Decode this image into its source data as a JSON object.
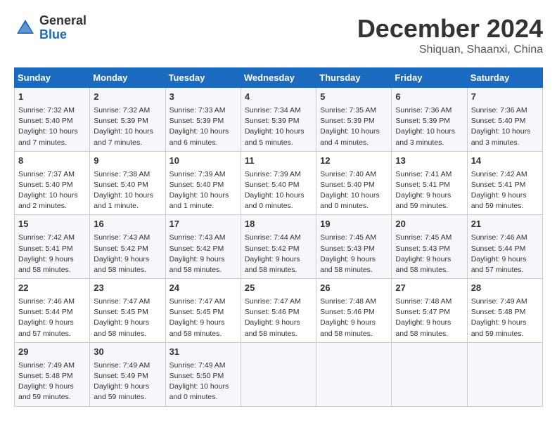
{
  "header": {
    "logo_general": "General",
    "logo_blue": "Blue",
    "month_year": "December 2024",
    "location": "Shiquan, Shaanxi, China"
  },
  "days_of_week": [
    "Sunday",
    "Monday",
    "Tuesday",
    "Wednesday",
    "Thursday",
    "Friday",
    "Saturday"
  ],
  "weeks": [
    [
      {
        "day": "1",
        "info": "Sunrise: 7:32 AM\nSunset: 5:40 PM\nDaylight: 10 hours and 7 minutes."
      },
      {
        "day": "2",
        "info": "Sunrise: 7:32 AM\nSunset: 5:39 PM\nDaylight: 10 hours and 7 minutes."
      },
      {
        "day": "3",
        "info": "Sunrise: 7:33 AM\nSunset: 5:39 PM\nDaylight: 10 hours and 6 minutes."
      },
      {
        "day": "4",
        "info": "Sunrise: 7:34 AM\nSunset: 5:39 PM\nDaylight: 10 hours and 5 minutes."
      },
      {
        "day": "5",
        "info": "Sunrise: 7:35 AM\nSunset: 5:39 PM\nDaylight: 10 hours and 4 minutes."
      },
      {
        "day": "6",
        "info": "Sunrise: 7:36 AM\nSunset: 5:39 PM\nDaylight: 10 hours and 3 minutes."
      },
      {
        "day": "7",
        "info": "Sunrise: 7:36 AM\nSunset: 5:40 PM\nDaylight: 10 hours and 3 minutes."
      }
    ],
    [
      {
        "day": "8",
        "info": "Sunrise: 7:37 AM\nSunset: 5:40 PM\nDaylight: 10 hours and 2 minutes."
      },
      {
        "day": "9",
        "info": "Sunrise: 7:38 AM\nSunset: 5:40 PM\nDaylight: 10 hours and 1 minute."
      },
      {
        "day": "10",
        "info": "Sunrise: 7:39 AM\nSunset: 5:40 PM\nDaylight: 10 hours and 1 minute."
      },
      {
        "day": "11",
        "info": "Sunrise: 7:39 AM\nSunset: 5:40 PM\nDaylight: 10 hours and 0 minutes."
      },
      {
        "day": "12",
        "info": "Sunrise: 7:40 AM\nSunset: 5:40 PM\nDaylight: 10 hours and 0 minutes."
      },
      {
        "day": "13",
        "info": "Sunrise: 7:41 AM\nSunset: 5:41 PM\nDaylight: 9 hours and 59 minutes."
      },
      {
        "day": "14",
        "info": "Sunrise: 7:42 AM\nSunset: 5:41 PM\nDaylight: 9 hours and 59 minutes."
      }
    ],
    [
      {
        "day": "15",
        "info": "Sunrise: 7:42 AM\nSunset: 5:41 PM\nDaylight: 9 hours and 58 minutes."
      },
      {
        "day": "16",
        "info": "Sunrise: 7:43 AM\nSunset: 5:42 PM\nDaylight: 9 hours and 58 minutes."
      },
      {
        "day": "17",
        "info": "Sunrise: 7:43 AM\nSunset: 5:42 PM\nDaylight: 9 hours and 58 minutes."
      },
      {
        "day": "18",
        "info": "Sunrise: 7:44 AM\nSunset: 5:42 PM\nDaylight: 9 hours and 58 minutes."
      },
      {
        "day": "19",
        "info": "Sunrise: 7:45 AM\nSunset: 5:43 PM\nDaylight: 9 hours and 58 minutes."
      },
      {
        "day": "20",
        "info": "Sunrise: 7:45 AM\nSunset: 5:43 PM\nDaylight: 9 hours and 58 minutes."
      },
      {
        "day": "21",
        "info": "Sunrise: 7:46 AM\nSunset: 5:44 PM\nDaylight: 9 hours and 57 minutes."
      }
    ],
    [
      {
        "day": "22",
        "info": "Sunrise: 7:46 AM\nSunset: 5:44 PM\nDaylight: 9 hours and 57 minutes."
      },
      {
        "day": "23",
        "info": "Sunrise: 7:47 AM\nSunset: 5:45 PM\nDaylight: 9 hours and 58 minutes."
      },
      {
        "day": "24",
        "info": "Sunrise: 7:47 AM\nSunset: 5:45 PM\nDaylight: 9 hours and 58 minutes."
      },
      {
        "day": "25",
        "info": "Sunrise: 7:47 AM\nSunset: 5:46 PM\nDaylight: 9 hours and 58 minutes."
      },
      {
        "day": "26",
        "info": "Sunrise: 7:48 AM\nSunset: 5:46 PM\nDaylight: 9 hours and 58 minutes."
      },
      {
        "day": "27",
        "info": "Sunrise: 7:48 AM\nSunset: 5:47 PM\nDaylight: 9 hours and 58 minutes."
      },
      {
        "day": "28",
        "info": "Sunrise: 7:49 AM\nSunset: 5:48 PM\nDaylight: 9 hours and 59 minutes."
      }
    ],
    [
      {
        "day": "29",
        "info": "Sunrise: 7:49 AM\nSunset: 5:48 PM\nDaylight: 9 hours and 59 minutes."
      },
      {
        "day": "30",
        "info": "Sunrise: 7:49 AM\nSunset: 5:49 PM\nDaylight: 9 hours and 59 minutes."
      },
      {
        "day": "31",
        "info": "Sunrise: 7:49 AM\nSunset: 5:50 PM\nDaylight: 10 hours and 0 minutes."
      },
      null,
      null,
      null,
      null
    ]
  ]
}
